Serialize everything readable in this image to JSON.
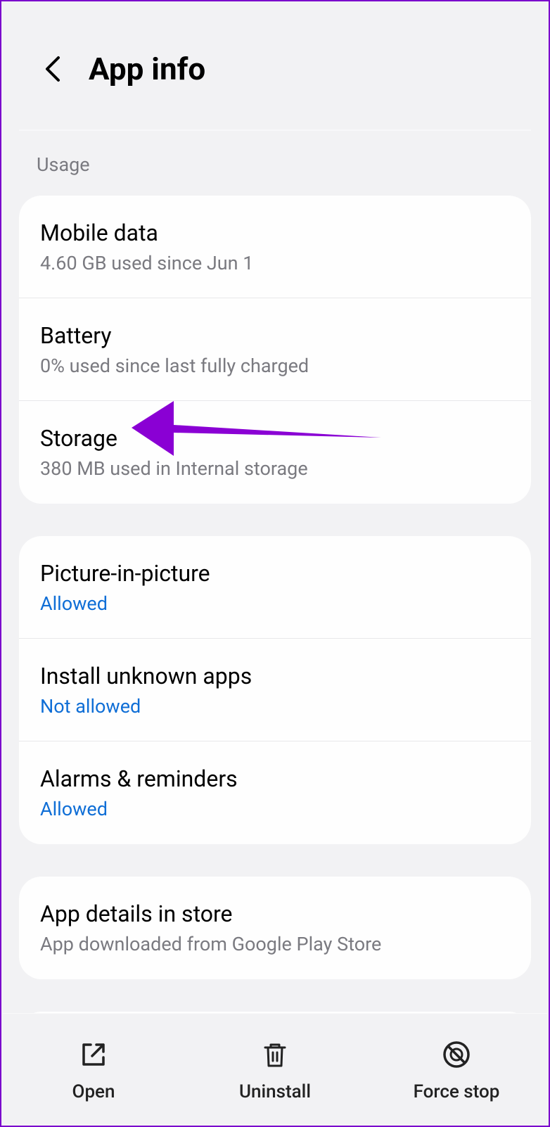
{
  "header": {
    "title": "App info"
  },
  "sections": {
    "usage_label": "Usage",
    "usage": [
      {
        "title": "Mobile data",
        "subtitle": "4.60 GB used since Jun 1"
      },
      {
        "title": "Battery",
        "subtitle": "0% used since last fully charged"
      },
      {
        "title": "Storage",
        "subtitle": "380 MB used in Internal storage"
      }
    ],
    "permissions": [
      {
        "title": "Picture-in-picture",
        "subtitle": "Allowed"
      },
      {
        "title": "Install unknown apps",
        "subtitle": "Not allowed"
      },
      {
        "title": "Alarms & reminders",
        "subtitle": "Allowed"
      }
    ],
    "store": [
      {
        "title": "App details in store",
        "subtitle": "App downloaded from Google Play Store"
      }
    ]
  },
  "bottom": {
    "open": "Open",
    "uninstall": "Uninstall",
    "force_stop": "Force stop"
  },
  "annotation": {
    "color": "#8a00d4"
  }
}
